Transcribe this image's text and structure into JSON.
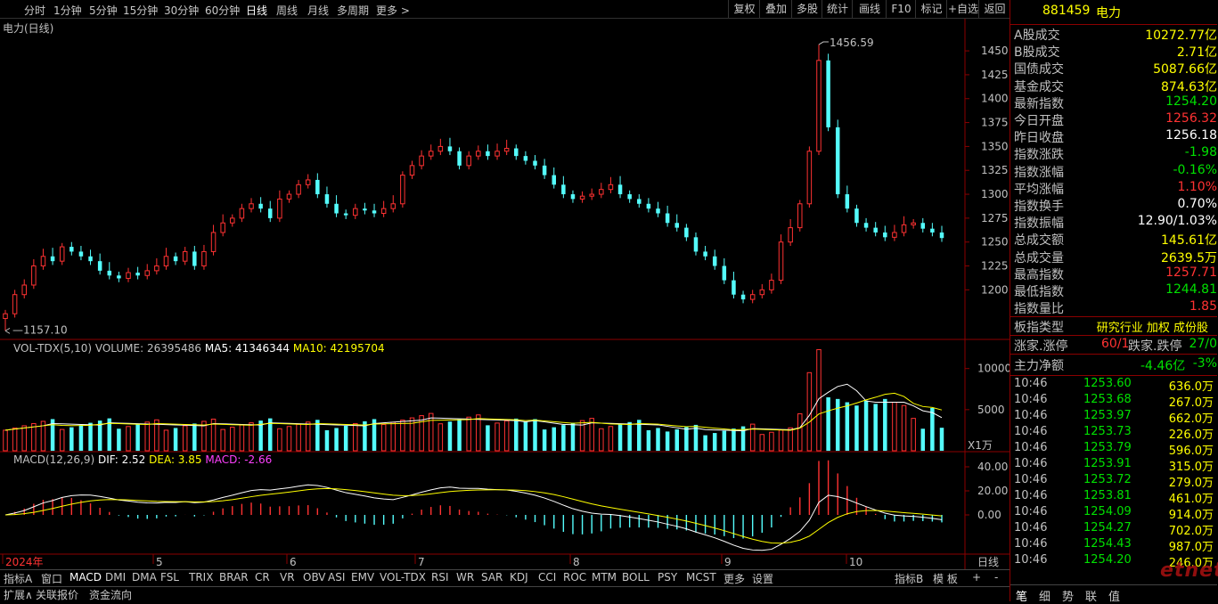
{
  "toolbar": {
    "periods": [
      "分时",
      "1分钟",
      "5分钟",
      "15分钟",
      "30分钟",
      "60分钟",
      "日线",
      "周线",
      "月线",
      "多周期",
      "更多 >"
    ],
    "active_period": "日线",
    "right_buttons": [
      "复权",
      "叠加",
      "多股",
      "统计",
      "画线",
      "F10",
      "标记",
      "+自选",
      "返回"
    ]
  },
  "chart": {
    "title": "电力(日线)",
    "price_axis": [
      "1450",
      "1425",
      "1400",
      "1375",
      "1350",
      "1325",
      "1300",
      "1275",
      "1250",
      "1225",
      "1200"
    ],
    "high_label": "1456.59",
    "low_label": "1157.10",
    "volume_legend": {
      "prefix": "VOL-TDX(5,10)",
      "volume": "VOLUME: 26395486",
      "ma5": "MA5: 41346344",
      "ma10": "MA10: 42195704"
    },
    "volume_axis": [
      "10000",
      "5000"
    ],
    "volume_unit": "X1万",
    "macd_legend": {
      "prefix": "MACD(12,26,9)",
      "dif": "DIF: 2.52",
      "dea": "DEA: 3.85",
      "macd": "MACD: -2.66"
    },
    "macd_axis": [
      "40.00",
      "20.00",
      "0.00"
    ],
    "date_axis": [
      "2024年",
      "5",
      "6",
      "7",
      "8",
      "9",
      "10"
    ],
    "date_axis_right": "日线",
    "colors": {
      "up": "#ff3232",
      "down": "#54fcfc",
      "ma5": "#ffffff",
      "ma10": "#ffff00",
      "macd_pos": "#ff3232",
      "macd_neg": "#54fcfc",
      "dif": "#ffffff",
      "dea": "#ffff00",
      "frame": "#8b0000"
    }
  },
  "chart_data": {
    "type": "candlestick",
    "title": "电力(日线)",
    "ylim": [
      1150,
      1465
    ],
    "high": 1456.59,
    "low": 1157.1,
    "close_series": [
      1175,
      1195,
      1205,
      1225,
      1235,
      1230,
      1245,
      1240,
      1235,
      1230,
      1220,
      1215,
      1212,
      1218,
      1215,
      1220,
      1225,
      1235,
      1230,
      1240,
      1225,
      1240,
      1260,
      1270,
      1275,
      1285,
      1290,
      1285,
      1275,
      1295,
      1300,
      1310,
      1315,
      1300,
      1290,
      1280,
      1278,
      1285,
      1283,
      1280,
      1285,
      1290,
      1320,
      1330,
      1340,
      1345,
      1350,
      1345,
      1330,
      1340,
      1345,
      1340,
      1345,
      1348,
      1340,
      1335,
      1330,
      1320,
      1310,
      1300,
      1295,
      1298,
      1300,
      1305,
      1310,
      1300,
      1295,
      1290,
      1285,
      1280,
      1270,
      1265,
      1255,
      1240,
      1235,
      1225,
      1210,
      1195,
      1190,
      1195,
      1200,
      1210,
      1250,
      1265,
      1290,
      1345,
      1440,
      1370,
      1300,
      1285,
      1270,
      1265,
      1260,
      1255,
      1260,
      1268,
      1270,
      1264,
      1260,
      1254.2
    ]
  },
  "info_panel": {
    "code": "881459",
    "name": "电力",
    "rows": [
      {
        "label": "A股成交",
        "value": "10272.77亿",
        "color": "#ffff00"
      },
      {
        "label": "B股成交",
        "value": "2.71亿",
        "color": "#ffff00"
      },
      {
        "label": "国债成交",
        "value": "5087.66亿",
        "color": "#ffff00"
      },
      {
        "label": "基金成交",
        "value": "874.63亿",
        "color": "#ffff00"
      },
      {
        "label": "最新指数",
        "value": "1254.20",
        "color": "#00e000"
      },
      {
        "label": "今日开盘",
        "value": "1256.32",
        "color": "#ff3232"
      },
      {
        "label": "昨日收盘",
        "value": "1256.18",
        "color": "#ffffff"
      },
      {
        "label": "指数涨跌",
        "value": "-1.98",
        "color": "#00e000"
      },
      {
        "label": "指数涨幅",
        "value": "-0.16%",
        "color": "#00e000"
      },
      {
        "label": "平均涨幅",
        "value": "1.10%",
        "color": "#ff3232"
      },
      {
        "label": "指数换手",
        "value": "0.70%",
        "color": "#ffffff"
      },
      {
        "label": "指数振幅",
        "value": "12.90/1.03%",
        "color": "#ffffff"
      },
      {
        "label": "总成交额",
        "value": "145.61亿",
        "color": "#ffff00"
      },
      {
        "label": "总成交量",
        "value": "2639.5万",
        "color": "#ffff00"
      },
      {
        "label": "最高指数",
        "value": "1257.71",
        "color": "#ff3232"
      },
      {
        "label": "最低指数",
        "value": "1244.81",
        "color": "#00e000"
      },
      {
        "label": "指数量比",
        "value": "1.85",
        "color": "#ff3232"
      }
    ],
    "sector_type_label": "板指类型",
    "sector_type_value": "研究行业 加权 成份股",
    "rise_label": "涨家.涨停",
    "rise_value": "60/1",
    "fall_label": "跌家.跌停",
    "fall_value": "27/0",
    "fund_label": "主力净额",
    "fund_value": "-4.46亿",
    "fund_pct": "-3%",
    "ticks": [
      {
        "time": "10:46",
        "price": "1253.60",
        "vol": "636.0万"
      },
      {
        "time": "10:46",
        "price": "1253.68",
        "vol": "267.0万"
      },
      {
        "time": "10:46",
        "price": "1253.97",
        "vol": "662.0万"
      },
      {
        "time": "10:46",
        "price": "1253.73",
        "vol": "226.0万"
      },
      {
        "time": "10:46",
        "price": "1253.79",
        "vol": "596.0万"
      },
      {
        "time": "10:46",
        "price": "1253.91",
        "vol": "315.0万"
      },
      {
        "time": "10:46",
        "price": "1253.72",
        "vol": "279.0万"
      },
      {
        "time": "10:46",
        "price": "1253.81",
        "vol": "461.0万"
      },
      {
        "time": "10:46",
        "price": "1254.09",
        "vol": "914.0万"
      },
      {
        "time": "10:46",
        "price": "1254.27",
        "vol": "702.0万"
      },
      {
        "time": "10:46",
        "price": "1254.43",
        "vol": "987.0万"
      },
      {
        "time": "10:46",
        "price": "1254.20",
        "vol": "246.0万"
      }
    ],
    "tabs": [
      "笔",
      "细",
      "势",
      "联",
      "值"
    ]
  },
  "indicator_bar": {
    "items": [
      "指标A",
      "窗口",
      "MACD",
      "DMI",
      "DMA",
      "FSL",
      "TRIX",
      "BRAR",
      "CR",
      "VR",
      "OBV",
      "ASI",
      "EMV",
      "VOL-TDX",
      "RSI",
      "WR",
      "SAR",
      "KDJ",
      "CCI",
      "ROC",
      "MTM",
      "BOLL",
      "PSY",
      "MCST",
      "更多",
      "设置"
    ],
    "active": "MACD",
    "right_items": [
      "指标B",
      "模 板",
      "+",
      "-"
    ]
  },
  "status_bar": {
    "items": [
      "扩展∧",
      "关联报价",
      "资金流向"
    ]
  },
  "watermark": "etnet"
}
